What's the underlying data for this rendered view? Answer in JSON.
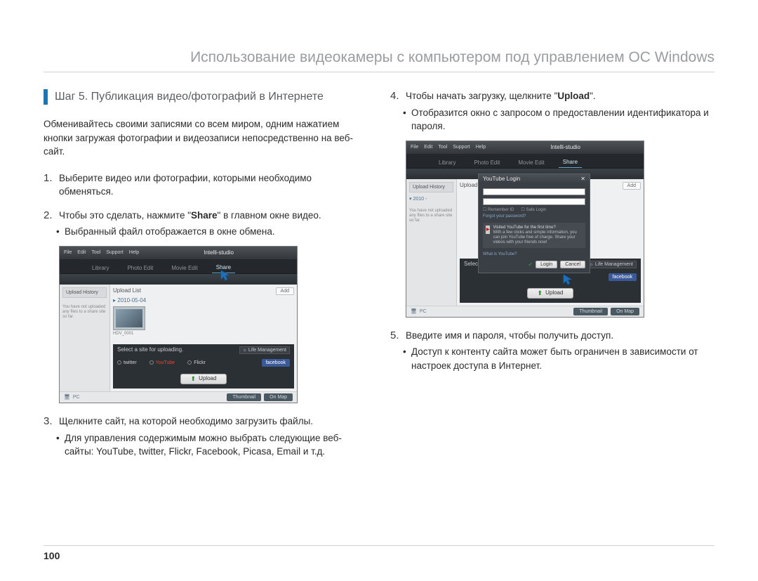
{
  "chapter_title": "Использование видеокамеры с компьютером под управлением ОС Windows",
  "section_heading": "Шаг 5. Публикация видео/фотографий в Интернете",
  "intro": "Обменивайтесь своими записями со всем миром, одним нажатием кнопки загружая фотографии и видеозаписи непосредственно на веб-сайт.",
  "steps": {
    "n1": "1.",
    "s1": "Выберите видео или фотографии, которыми необходимо обменяться.",
    "n2": "2.",
    "s2_prefix": "Чтобы это сделать, нажмите \"",
    "s2_bold": "Share",
    "s2_suffix": "\" в главном окне видео.",
    "s2_bullet": "Выбранный файл отображается в окне обмена.",
    "n3": "3.",
    "s3": "Щелкните сайт, на которой необходимо загрузить файлы.",
    "s3_bullet": "Для управления содержимым можно выбрать следующие веб-сайты: YouTube, twitter, Flickr, Facebook, Picasa, Email и т.д.",
    "n4": "4.",
    "s4_prefix": "Чтобы начать загрузку, щелкните \"",
    "s4_bold": "Upload",
    "s4_suffix": "\".",
    "s4_bullet": "Отобразится окно с запросом о предоставлении идентификатора и пароля.",
    "n5": "5.",
    "s5": "Введите имя и пароля, чтобы получить доступ.",
    "s5_bullet": "Доступ к контенту сайта может быть ограничен в зависимости от настроек доступа в Интернет."
  },
  "screenshot": {
    "app_name": "Intelli-studio",
    "menu": {
      "file": "File",
      "edit": "Edit",
      "tool": "Tool",
      "support": "Support",
      "help": "Help"
    },
    "tabs": {
      "library": "Library",
      "photo_edit": "Photo Edit",
      "movie_edit": "Movie Edit",
      "share": "Share"
    },
    "sidebar_header": "Upload History",
    "sidebar_note": "You have not uploaded any files to a share site so far.",
    "main_header": "Upload List",
    "add_btn": "Add",
    "date": "2010-05-04",
    "thumb_label": "HDV_0001",
    "select_bar": "Select a site for uploading.",
    "life_mgmt": "Life Management",
    "sites": {
      "twitter": "twitter",
      "youtube": "YouTube",
      "flickr": "Flickr",
      "facebook": "facebook"
    },
    "upload_btn": "Upload",
    "bottom_pc": "PC",
    "bottom_thumbnail": "Thumbnail",
    "bottom_onmap": "On Map",
    "login": {
      "title": "YouTube Login",
      "remember": "Remember ID",
      "safe": "Safe Login",
      "forgot": "Forgot your password?",
      "brand_q": "Visited YouTube for the first time?",
      "brand_note": "With a few clicks and simple information, you can join YouTube free of charge. Share your videos with your friends now!",
      "whatis": "What is YouTube?",
      "login_btn": "Login",
      "cancel_btn": "Cancel"
    }
  },
  "page_number": "100"
}
